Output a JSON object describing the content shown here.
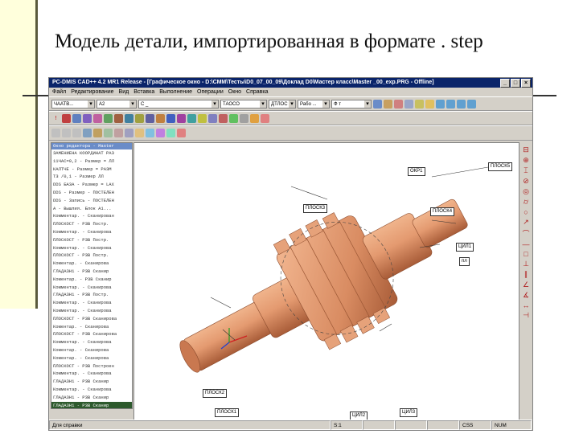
{
  "slide": {
    "title": "Модель детали, импортированная в формате . step"
  },
  "window": {
    "title": "PC-DMIS CAD++ 4.2 MR1 Release - [Графическое окно - D:\\СММ\\Тесты\\D0_07_00_09\\Доклад D0\\Мастер класс\\Master _00_exp.PRG - Offline]",
    "menu": [
      "Файл",
      "Редактирование",
      "Вид",
      "Вставка",
      "Выполнение",
      "Операции",
      "Окно",
      "Справка"
    ],
    "combos": [
      "ЧААТВ...",
      "А2",
      "С _",
      "ТАОСО",
      "ДТЛОС",
      "Рабо ...",
      "Ф т"
    ],
    "title_bar_color": "#0a246a",
    "panel_color": "#d4d0c8"
  },
  "tree": {
    "header": "Окно редактора - Master",
    "rows": [
      "ЗАМЕНИЕНА КООРДИНАТ РАЗ",
      "11ЧАС=0,2 - Размер = ЛЛ",
      "КАЛТЧЕ - Размер = РАЗМ",
      "ТЗ /0,1 - Размер  ЛЛ",
      "DDS БАЗА - Размер = LAX",
      "DDS - Размер - ПОСТЕЛЕН",
      "DDS - Запись - ПОСТЕЛЕН",
      "А - Вышлия. Блок А1...",
      "Комментар. - Сканирован",
      "ПЛОСКОСТ - РЗВ Постр.",
      "Комментар. - Сканирова",
      "ПЛОСКОСТ - РЗВ Постр.",
      "Комментар. - Сканирова",
      "ПЛОСКОСТ - РЗВ Постр.",
      "Коментар. - Сканирова",
      "ГЛАДАЗН1 - РЗВ Сканир",
      "Коментар. - РЗВ Сканир",
      "Комментар. - Сканирова",
      "ГЛАДАЗН1 - РЗВ Постр.",
      "Комментар. - Сканирова",
      "Комментар. - Сканирова",
      "ПЛОСКОСТ - РЗВ Сканирова",
      "Коментар. - Сканирова",
      "ПЛОСКОСТ - РЗВ Сканирова",
      "Комментар. - Сканирова",
      "Коментар. - Сканирова",
      "Коментар. - Сканирова",
      "ПЛОСКОСТ - РЗВ Построен",
      "Комментар. - Сканирова",
      "ГЛАДАЗН1 - РЗВ Сканир",
      "Комментар. - Сканирова",
      "ГЛАДАЗН1 - РЗВ Сканир",
      "ГЛАДАЗН1 - РЗВ Сканир"
    ]
  },
  "viewport": {
    "part_color": "#d9936a",
    "labels": {
      "okr1": "ОКР1",
      "plosk5": "ПЛОСК5",
      "plosk3": "ПЛОСК3",
      "plosk4": "ПЛОСК4",
      "cil1": "ЦИЛ1",
      "pl": "пл",
      "plosk2": "ПЛОСК2",
      "plosk1": "ПЛОСК1",
      "cil2": "ЦИЛ2",
      "cil3": "ЦИЛ3"
    }
  },
  "status": {
    "left": "Для справки",
    "cells": [
      "S:1",
      "",
      "",
      "",
      "CSS",
      "NUM"
    ]
  }
}
